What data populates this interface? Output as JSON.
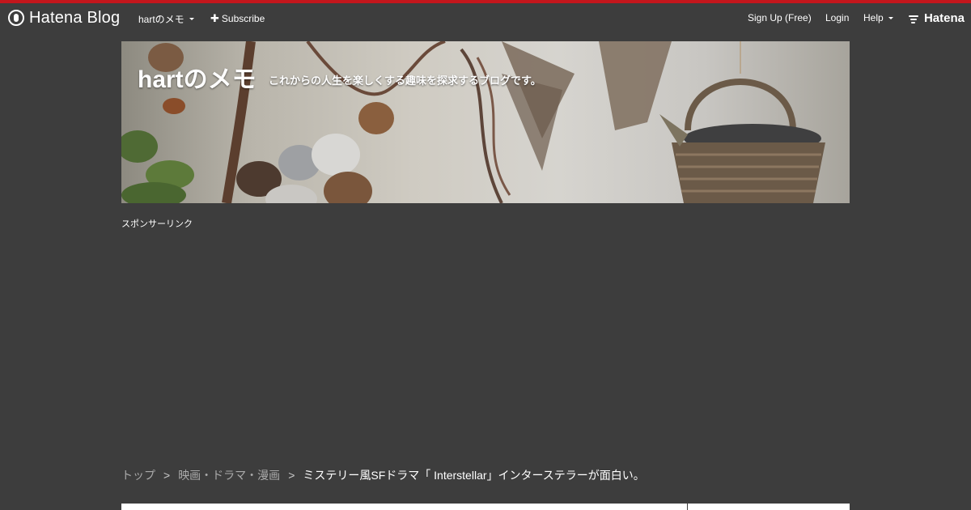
{
  "globalheader": {
    "logo_text": "Hatena Blog",
    "blog_menu": "hartのメモ",
    "subscribe": "Subscribe",
    "signup": "Sign Up (Free)",
    "login": "Login",
    "help": "Help",
    "brand": "Hatena",
    "accent_color": "#c3161c"
  },
  "header": {
    "title": "hartのメモ",
    "description": "これからの人生を楽しくする趣味を探求するブログです。"
  },
  "sponsor_label": "スポンサーリンク",
  "breadcrumb": {
    "items": [
      "トップ",
      "映画・ドラマ・漫画"
    ],
    "current": "ミステリー風SFドラマ「 Interstellar」インターステラーが面白い。"
  }
}
